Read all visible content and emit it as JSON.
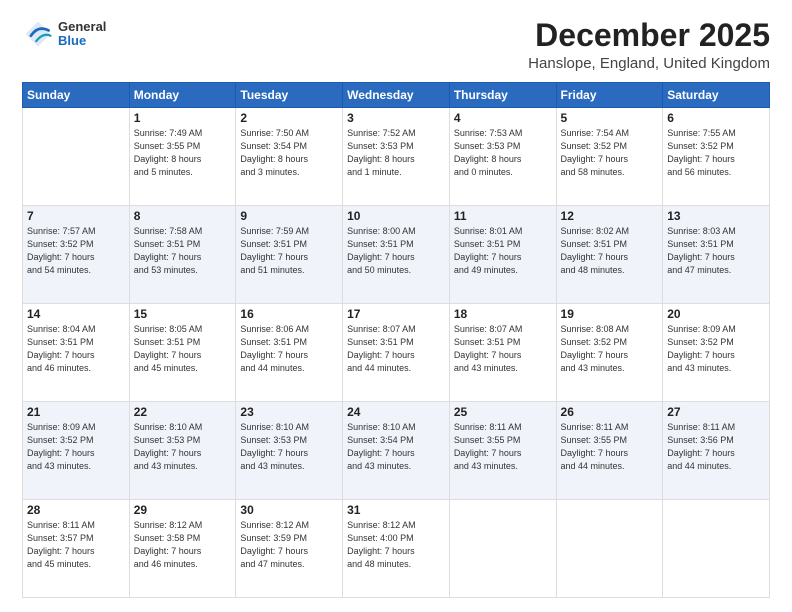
{
  "header": {
    "logo_general": "General",
    "logo_blue": "Blue",
    "month": "December 2025",
    "location": "Hanslope, England, United Kingdom"
  },
  "weekdays": [
    "Sunday",
    "Monday",
    "Tuesday",
    "Wednesday",
    "Thursday",
    "Friday",
    "Saturday"
  ],
  "weeks": [
    [
      {
        "day": "",
        "info": ""
      },
      {
        "day": "1",
        "info": "Sunrise: 7:49 AM\nSunset: 3:55 PM\nDaylight: 8 hours\nand 5 minutes."
      },
      {
        "day": "2",
        "info": "Sunrise: 7:50 AM\nSunset: 3:54 PM\nDaylight: 8 hours\nand 3 minutes."
      },
      {
        "day": "3",
        "info": "Sunrise: 7:52 AM\nSunset: 3:53 PM\nDaylight: 8 hours\nand 1 minute."
      },
      {
        "day": "4",
        "info": "Sunrise: 7:53 AM\nSunset: 3:53 PM\nDaylight: 8 hours\nand 0 minutes."
      },
      {
        "day": "5",
        "info": "Sunrise: 7:54 AM\nSunset: 3:52 PM\nDaylight: 7 hours\nand 58 minutes."
      },
      {
        "day": "6",
        "info": "Sunrise: 7:55 AM\nSunset: 3:52 PM\nDaylight: 7 hours\nand 56 minutes."
      }
    ],
    [
      {
        "day": "7",
        "info": "Sunrise: 7:57 AM\nSunset: 3:52 PM\nDaylight: 7 hours\nand 54 minutes."
      },
      {
        "day": "8",
        "info": "Sunrise: 7:58 AM\nSunset: 3:51 PM\nDaylight: 7 hours\nand 53 minutes."
      },
      {
        "day": "9",
        "info": "Sunrise: 7:59 AM\nSunset: 3:51 PM\nDaylight: 7 hours\nand 51 minutes."
      },
      {
        "day": "10",
        "info": "Sunrise: 8:00 AM\nSunset: 3:51 PM\nDaylight: 7 hours\nand 50 minutes."
      },
      {
        "day": "11",
        "info": "Sunrise: 8:01 AM\nSunset: 3:51 PM\nDaylight: 7 hours\nand 49 minutes."
      },
      {
        "day": "12",
        "info": "Sunrise: 8:02 AM\nSunset: 3:51 PM\nDaylight: 7 hours\nand 48 minutes."
      },
      {
        "day": "13",
        "info": "Sunrise: 8:03 AM\nSunset: 3:51 PM\nDaylight: 7 hours\nand 47 minutes."
      }
    ],
    [
      {
        "day": "14",
        "info": "Sunrise: 8:04 AM\nSunset: 3:51 PM\nDaylight: 7 hours\nand 46 minutes."
      },
      {
        "day": "15",
        "info": "Sunrise: 8:05 AM\nSunset: 3:51 PM\nDaylight: 7 hours\nand 45 minutes."
      },
      {
        "day": "16",
        "info": "Sunrise: 8:06 AM\nSunset: 3:51 PM\nDaylight: 7 hours\nand 44 minutes."
      },
      {
        "day": "17",
        "info": "Sunrise: 8:07 AM\nSunset: 3:51 PM\nDaylight: 7 hours\nand 44 minutes."
      },
      {
        "day": "18",
        "info": "Sunrise: 8:07 AM\nSunset: 3:51 PM\nDaylight: 7 hours\nand 43 minutes."
      },
      {
        "day": "19",
        "info": "Sunrise: 8:08 AM\nSunset: 3:52 PM\nDaylight: 7 hours\nand 43 minutes."
      },
      {
        "day": "20",
        "info": "Sunrise: 8:09 AM\nSunset: 3:52 PM\nDaylight: 7 hours\nand 43 minutes."
      }
    ],
    [
      {
        "day": "21",
        "info": "Sunrise: 8:09 AM\nSunset: 3:52 PM\nDaylight: 7 hours\nand 43 minutes."
      },
      {
        "day": "22",
        "info": "Sunrise: 8:10 AM\nSunset: 3:53 PM\nDaylight: 7 hours\nand 43 minutes."
      },
      {
        "day": "23",
        "info": "Sunrise: 8:10 AM\nSunset: 3:53 PM\nDaylight: 7 hours\nand 43 minutes."
      },
      {
        "day": "24",
        "info": "Sunrise: 8:10 AM\nSunset: 3:54 PM\nDaylight: 7 hours\nand 43 minutes."
      },
      {
        "day": "25",
        "info": "Sunrise: 8:11 AM\nSunset: 3:55 PM\nDaylight: 7 hours\nand 43 minutes."
      },
      {
        "day": "26",
        "info": "Sunrise: 8:11 AM\nSunset: 3:55 PM\nDaylight: 7 hours\nand 44 minutes."
      },
      {
        "day": "27",
        "info": "Sunrise: 8:11 AM\nSunset: 3:56 PM\nDaylight: 7 hours\nand 44 minutes."
      }
    ],
    [
      {
        "day": "28",
        "info": "Sunrise: 8:11 AM\nSunset: 3:57 PM\nDaylight: 7 hours\nand 45 minutes."
      },
      {
        "day": "29",
        "info": "Sunrise: 8:12 AM\nSunset: 3:58 PM\nDaylight: 7 hours\nand 46 minutes."
      },
      {
        "day": "30",
        "info": "Sunrise: 8:12 AM\nSunset: 3:59 PM\nDaylight: 7 hours\nand 47 minutes."
      },
      {
        "day": "31",
        "info": "Sunrise: 8:12 AM\nSunset: 4:00 PM\nDaylight: 7 hours\nand 48 minutes."
      },
      {
        "day": "",
        "info": ""
      },
      {
        "day": "",
        "info": ""
      },
      {
        "day": "",
        "info": ""
      }
    ]
  ]
}
